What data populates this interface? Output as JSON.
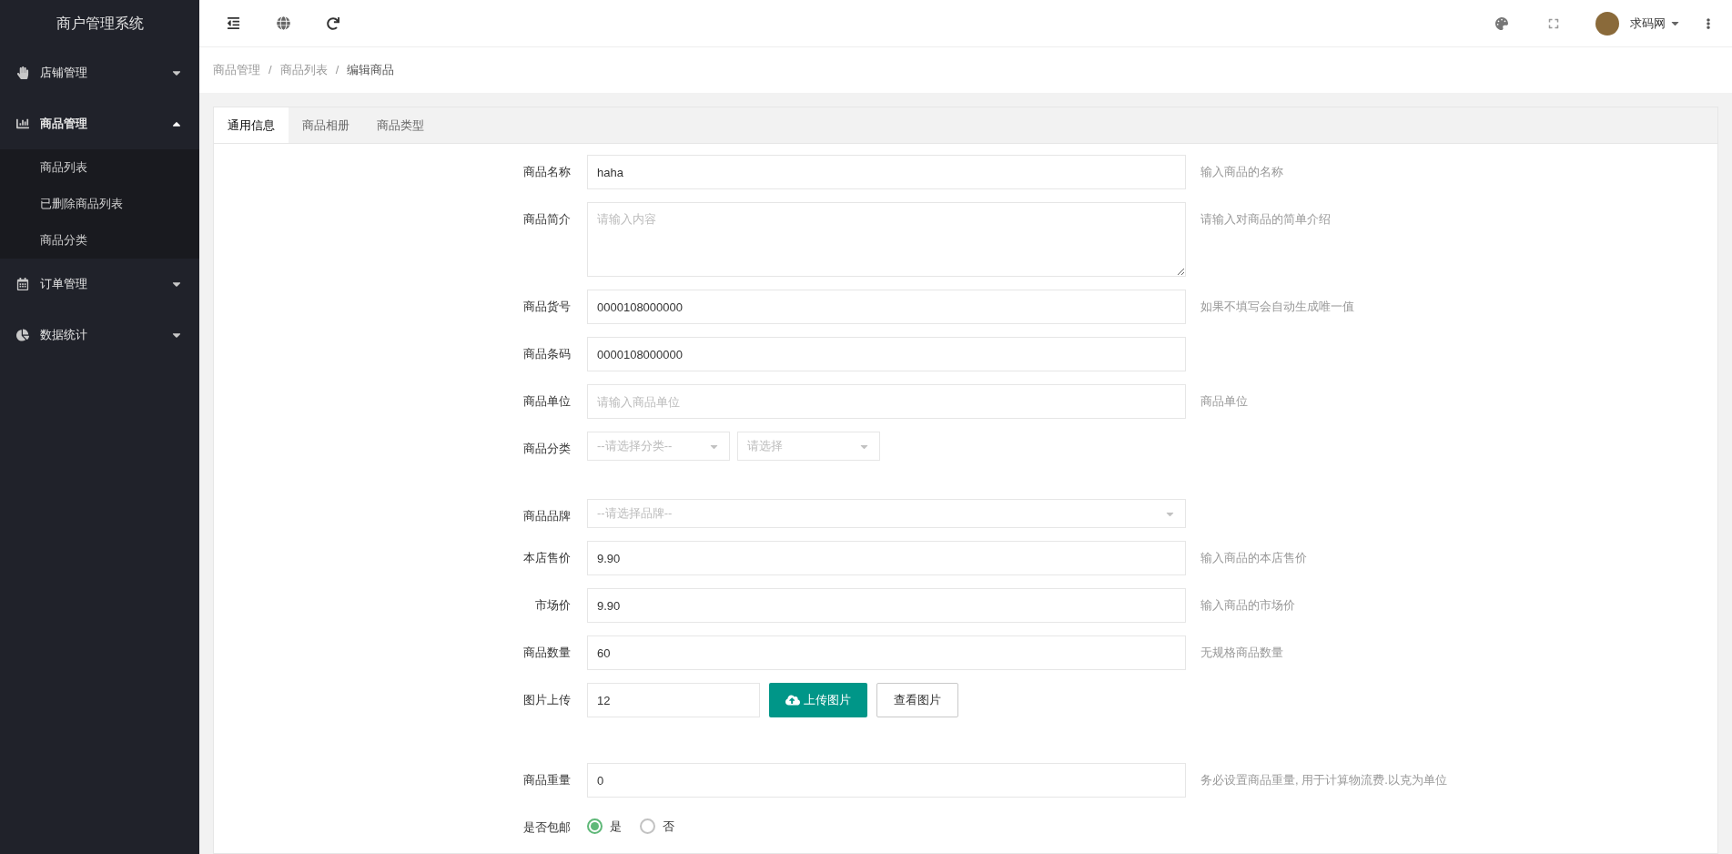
{
  "sidebar": {
    "title": "商户管理系统",
    "menu": [
      {
        "label": "店铺管理",
        "expanded": false
      },
      {
        "label": "商品管理",
        "expanded": true,
        "children": [
          {
            "label": "商品列表",
            "selected": false
          },
          {
            "label": "已删除商品列表",
            "selected": false
          },
          {
            "label": "商品分类",
            "selected": false
          }
        ]
      },
      {
        "label": "订单管理",
        "expanded": false
      },
      {
        "label": "数据统计",
        "expanded": false
      }
    ]
  },
  "topbar": {
    "user": "求码网"
  },
  "breadcrumb": {
    "separator": "/",
    "items": [
      "商品管理",
      "商品列表",
      "编辑商品"
    ]
  },
  "tabs": [
    {
      "label": "通用信息",
      "selected": true
    },
    {
      "label": "商品相册",
      "selected": false
    },
    {
      "label": "商品类型",
      "selected": false
    }
  ],
  "form": [
    {
      "kind": "input",
      "label": "商品名称",
      "value": "haha",
      "help": "输入商品的名称"
    },
    {
      "kind": "textarea",
      "label": "商品简介",
      "placeholder": "请输入内容",
      "help": "请输入对商品的简单介绍"
    },
    {
      "kind": "input",
      "label": "商品货号",
      "value": "0000108000000",
      "help": "如果不填写会自动生成唯一值"
    },
    {
      "kind": "input",
      "label": "商品条码",
      "value": "0000108000000"
    },
    {
      "kind": "input",
      "label": "商品单位",
      "placeholder": "请输入商品单位",
      "help": "商品单位"
    },
    {
      "kind": "selects",
      "label": "商品分类",
      "selects": [
        "--请选择分类--",
        "请选择"
      ]
    },
    {
      "kind": "spacer"
    },
    {
      "kind": "select",
      "label": "商品品牌",
      "placeholder": "--请选择品牌--"
    },
    {
      "kind": "input",
      "label": "本店售价",
      "value": "9.90",
      "help": "输入商品的本店售价"
    },
    {
      "kind": "input",
      "label": "市场价",
      "value": "9.90",
      "help": "输入商品的市场价"
    },
    {
      "kind": "input",
      "label": "商品数量",
      "value": "60",
      "help": "无规格商品数量"
    },
    {
      "kind": "upload",
      "label": "图片上传",
      "value": "12",
      "buttons": [
        "上传图片",
        "查看图片"
      ]
    },
    {
      "kind": "spacer_large"
    },
    {
      "kind": "input",
      "label": "商品重量",
      "value": "0",
      "help": "务必设置商品重量, 用于计算物流费.以克为单位"
    },
    {
      "kind": "radio",
      "label": "是否包邮",
      "options": [
        {
          "label": "是",
          "selected": true
        },
        {
          "label": "否",
          "selected": false
        }
      ]
    }
  ]
}
